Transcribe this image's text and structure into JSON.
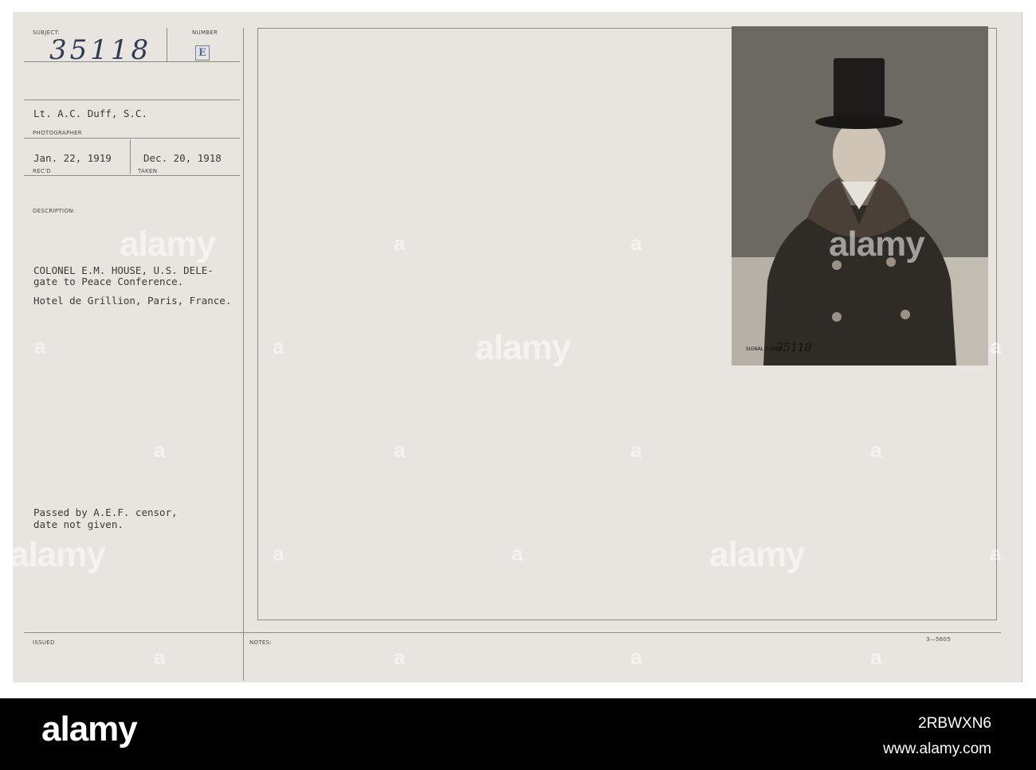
{
  "record": {
    "subject_label": "SUBJECT:",
    "number_label": "NUMBER",
    "subject_number": "35118",
    "number_value": "E",
    "photographer": "Lt. A.C. Duff, S.C.",
    "photographer_label": "PHOTOGRAPHER",
    "received_date": "Jan. 22, 1919",
    "received_label": "REC'D",
    "taken_date": "Dec. 20, 1918",
    "taken_label": "TAKEN",
    "description_label": "DESCRIPTION:",
    "description_lines": [
      "COLONEL E.M. HOUSE, U.S. DELE-",
      "gate to Peace Conference.",
      "Hotel de Grillion, Paris, France."
    ],
    "censor_lines": [
      "Passed by A.E.F. censor,",
      "date not given."
    ],
    "issued_label": "ISSUED",
    "notes_label": "NOTES:",
    "form_code": "3—5605",
    "photo_stamp": "SIGNAL CORPS",
    "photo_number": "35118"
  },
  "watermark": {
    "word": "alamy",
    "letter": "a"
  },
  "footer": {
    "logo": "alamy",
    "image_id": "2RBWXN6",
    "url": "www.alamy.com"
  }
}
